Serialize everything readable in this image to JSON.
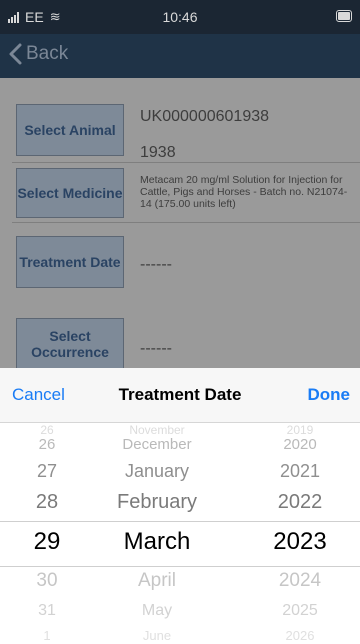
{
  "status": {
    "carrier": "EE",
    "time": "10:46"
  },
  "nav": {
    "back_label": "Back"
  },
  "form": {
    "rows": [
      {
        "button": "Select Animal",
        "values": [
          "UK000000601938",
          "1938"
        ]
      },
      {
        "button": "Select Medicine",
        "values": [
          "Metacam 20 mg/ml Solution for Injection for Cattle, Pigs and Horses - Batch no. N21074-14 (175.00 units left)"
        ]
      },
      {
        "button": "Treatment Date",
        "values": [
          "------"
        ]
      },
      {
        "button": "Select Occurrence",
        "values": [
          "------"
        ]
      }
    ]
  },
  "picker": {
    "cancel": "Cancel",
    "title": "Treatment Date",
    "done": "Done",
    "days": [
      "26",
      "26",
      "27",
      "28",
      "29",
      "30",
      "31",
      "1"
    ],
    "months": [
      "November",
      "December",
      "January",
      "February",
      "March",
      "April",
      "May",
      "June"
    ],
    "years": [
      "2019",
      "2020",
      "2021",
      "2022",
      "2023",
      "2024",
      "2025",
      "2026"
    ],
    "selected": {
      "day": "29",
      "month": "March",
      "year": "2023"
    }
  }
}
